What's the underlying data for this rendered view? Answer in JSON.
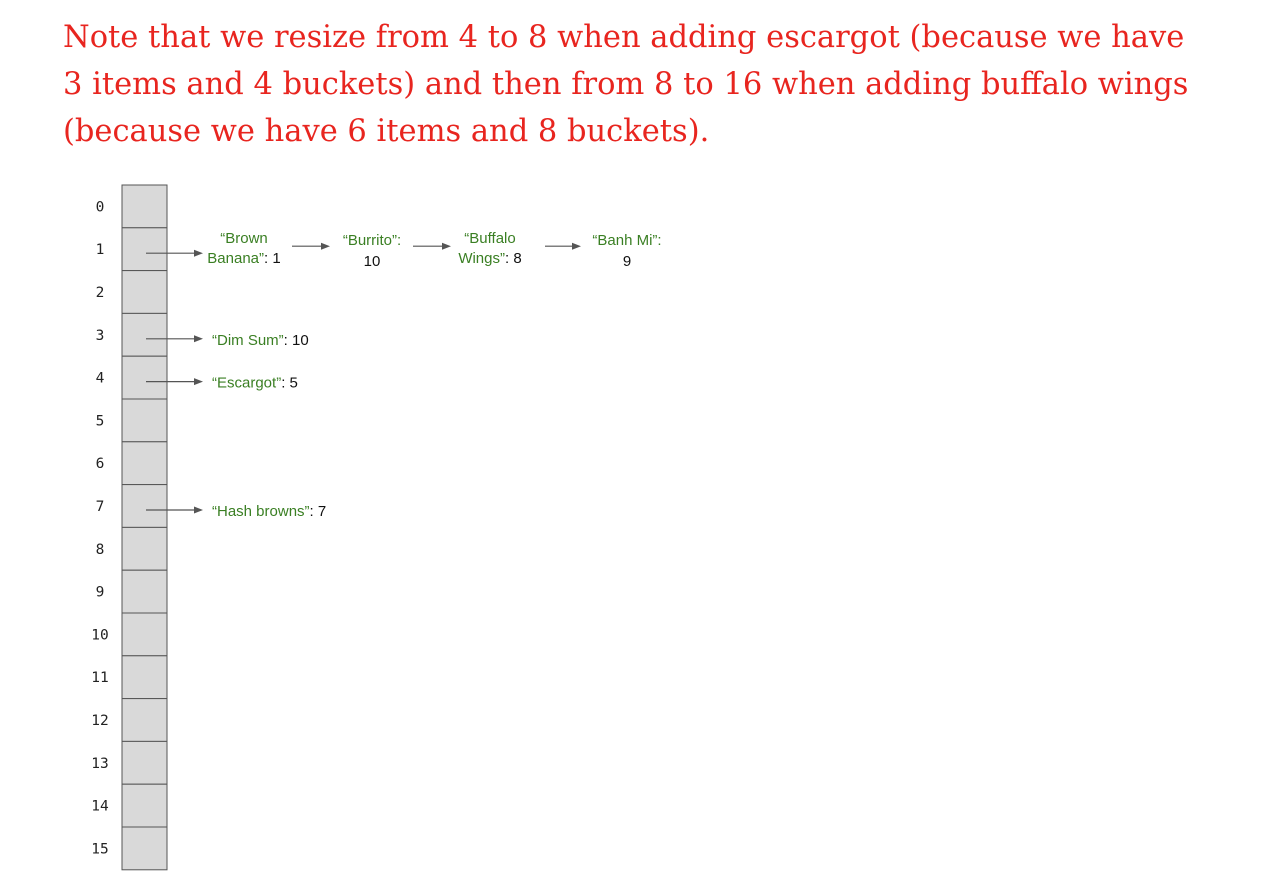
{
  "note": "Note that we resize from 4 to 8 when adding escargot (because we have 3 items and 4 buckets) and then from 8 to 16 when adding buffalo wings (because we have 6 items and 8 buckets).",
  "buckets": [
    "0",
    "1",
    "2",
    "3",
    "4",
    "5",
    "6",
    "7",
    "8",
    "9",
    "10",
    "11",
    "12",
    "13",
    "14",
    "15"
  ],
  "entries": [
    {
      "bucket": 1,
      "nodes": [
        {
          "key_lines": [
            "“Brown",
            "Banana”"
          ],
          "value": "1",
          "layout": "trail"
        },
        {
          "key_lines": [
            "“Burrito”:"
          ],
          "value": "10",
          "layout": "below"
        },
        {
          "key_lines": [
            "“Buffalo",
            "Wings”"
          ],
          "value": "8",
          "layout": "trail"
        },
        {
          "key_lines": [
            "“Banh Mi”:"
          ],
          "value": "9",
          "layout": "below"
        }
      ]
    },
    {
      "bucket": 3,
      "nodes": [
        {
          "key_lines": [
            "“Dim Sum”"
          ],
          "value": "10",
          "layout": "inline"
        }
      ]
    },
    {
      "bucket": 4,
      "nodes": [
        {
          "key_lines": [
            "“Escargot”"
          ],
          "value": "5",
          "layout": "inline"
        }
      ]
    },
    {
      "bucket": 7,
      "nodes": [
        {
          "key_lines": [
            "“Hash browns”"
          ],
          "value": "7",
          "layout": "inline"
        }
      ]
    }
  ]
}
